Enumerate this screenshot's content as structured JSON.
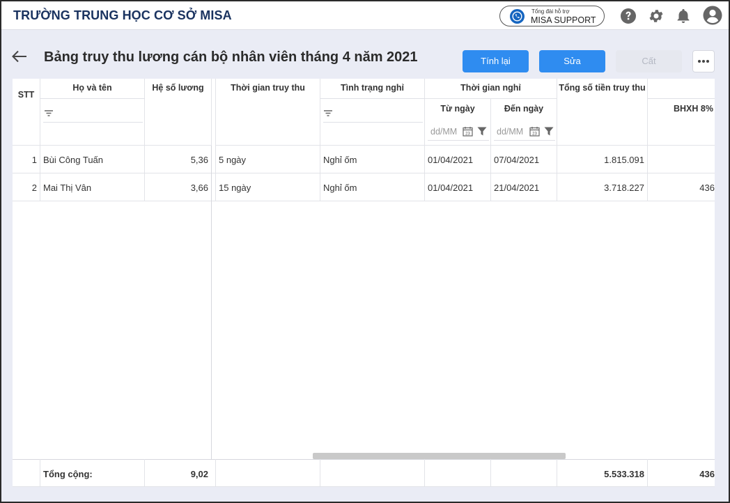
{
  "header": {
    "app_title": "TRƯỜNG TRUNG HỌC CƠ SỞ MISA",
    "support_small": "Tổng đài hỗ trợ",
    "support_label": "MISA SUPPORT"
  },
  "page": {
    "title": "Bảng truy thu lương cán bộ nhân viên tháng 4 năm 2021",
    "buttons": {
      "recalc": "Tính lại",
      "edit": "Sửa",
      "save": "Cất"
    }
  },
  "table": {
    "columns": {
      "stt": "STT",
      "name": "Họ và tên",
      "coef": "Hệ số lương",
      "period": "Thời gian truy thu",
      "leave_status": "Tình trạng nghỉ",
      "leave_time": "Thời gian nghỉ",
      "from": "Từ ngày",
      "to": "Đến ngày",
      "total": "Tổng số tiền truy thu",
      "bhxh": "BHXH 8%"
    },
    "date_placeholder": "dd/MM",
    "rows": [
      {
        "stt": "1",
        "name": "Bùi Công Tuấn",
        "coef": "5,36",
        "period": "5 ngày",
        "status": "Nghỉ ốm",
        "from": "01/04/2021",
        "to": "07/04/2021",
        "total": "1.815.091",
        "bhxh": ""
      },
      {
        "stt": "2",
        "name": "Mai Thị Vân",
        "coef": "3,66",
        "period": "15 ngày",
        "status": "Nghỉ ốm",
        "from": "01/04/2021",
        "to": "21/04/2021",
        "total": "3.718.227",
        "bhxh": "436"
      }
    ],
    "footer": {
      "label": "Tổng cộng:",
      "coef": "9,02",
      "total": "5.533.318",
      "bhxh": "436"
    }
  },
  "colors": {
    "accent": "#2f8cf0",
    "title": "#1a3360",
    "background": "#eaecf5"
  }
}
